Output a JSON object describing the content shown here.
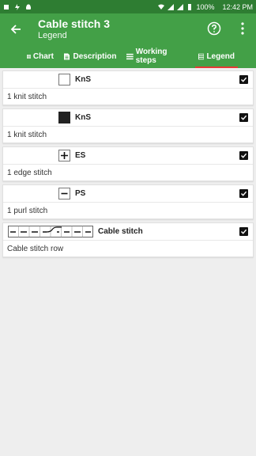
{
  "status": {
    "battery": "100%",
    "time": "12:42 PM"
  },
  "appbar": {
    "title": "Cable stitch 3",
    "subtitle": "Legend"
  },
  "tabs": [
    {
      "label": "Chart",
      "icon": "grid-icon"
    },
    {
      "label": "Description",
      "icon": "document-icon"
    },
    {
      "label": "Working steps",
      "icon": "list-icon"
    },
    {
      "label": "Legend",
      "icon": "legend-icon",
      "active": true
    }
  ],
  "legend": [
    {
      "abbr": "KnS",
      "symbol": "white-square",
      "description": "1 knit stitch",
      "checked": true
    },
    {
      "abbr": "KnS",
      "symbol": "black-square",
      "description": "1 knit stitch",
      "checked": true
    },
    {
      "abbr": "ES",
      "symbol": "plus",
      "description": "1 edge stitch",
      "checked": true
    },
    {
      "abbr": "PS",
      "symbol": "minus",
      "description": "1 purl stitch",
      "checked": true
    },
    {
      "abbr": "Cable stitch",
      "symbol": "cable-row",
      "description": "Cable stitch row",
      "checked": true
    }
  ],
  "colors": {
    "statusbar": "#2e7d32",
    "appbar": "#43a047",
    "tab_indicator": "#e53935"
  }
}
